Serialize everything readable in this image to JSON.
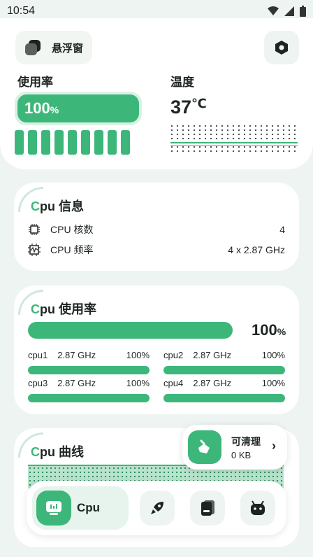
{
  "status_bar": {
    "time": "10:54"
  },
  "header": {
    "float_label": "悬浮窗",
    "usage_label": "使用率",
    "usage_value": "100",
    "usage_unit": "%",
    "usage_level": 1.0,
    "temp_label": "温度",
    "temp_value": "37",
    "temp_unit": "℃"
  },
  "cpu_info": {
    "title_c": "C",
    "title_rest": "pu 信息",
    "rows": [
      {
        "label": "CPU 核数",
        "value": "4",
        "icon": "chip-icon"
      },
      {
        "label": "CPU 频率",
        "value": "4 x 2.87 GHz",
        "icon": "frequency-icon"
      }
    ]
  },
  "cpu_usage": {
    "title_c": "C",
    "title_rest": "pu 使用率",
    "total_value": "100",
    "total_unit": "%",
    "total_level": 1.0,
    "cores": [
      {
        "name": "cpu1",
        "freq": "2.87 GHz",
        "pct": "100%"
      },
      {
        "name": "cpu2",
        "freq": "2.87 GHz",
        "pct": "100%"
      },
      {
        "name": "cpu3",
        "freq": "2.87 GHz",
        "pct": "100%"
      },
      {
        "name": "cpu4",
        "freq": "2.87 GHz",
        "pct": "100%"
      }
    ]
  },
  "cpu_curve": {
    "title_c": "C",
    "title_rest": "pu 曲线"
  },
  "clean_popup": {
    "title": "可清理",
    "size": "0 KB",
    "icon": "broom-icon"
  },
  "bottom_nav": {
    "active_label": "Cpu",
    "items": [
      "cpu-icon",
      "rocket-icon",
      "storage-icon",
      "android-icon"
    ]
  },
  "colors": {
    "accent": "#3db67a",
    "accent_light": "#d9f1e4",
    "background": "#eef4f1"
  }
}
